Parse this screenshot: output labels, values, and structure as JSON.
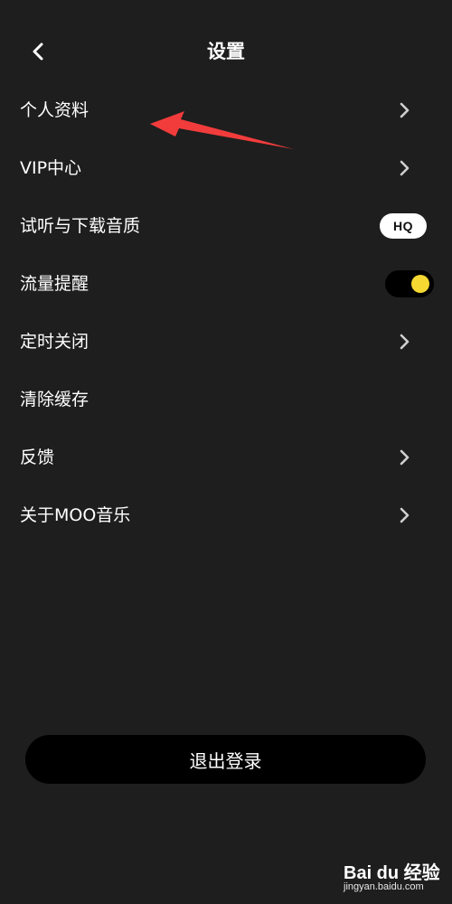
{
  "header": {
    "title": "设置",
    "back_icon": "chevron-left-icon"
  },
  "menu": {
    "items": [
      {
        "label": "个人资料",
        "control": "chevron"
      },
      {
        "label": "VIP中心",
        "control": "chevron"
      },
      {
        "label": "试听与下载音质",
        "control": "badge",
        "badge": "HQ"
      },
      {
        "label": "流量提醒",
        "control": "toggle",
        "toggle_on": true
      },
      {
        "label": "定时关闭",
        "control": "chevron"
      },
      {
        "label": "清除缓存",
        "control": "none"
      },
      {
        "label": "反馈",
        "control": "chevron"
      },
      {
        "label": "关于MOO音乐",
        "control": "chevron"
      }
    ]
  },
  "footer": {
    "logout_label": "退出登录"
  },
  "annotation": {
    "arrow_color": "#f23c3c"
  },
  "watermark": {
    "brand": "Bai du 经验",
    "url": "jingyan.baidu.com"
  },
  "colors": {
    "background": "#1e1e1e",
    "accent": "#f5d832",
    "text": "#ffffff"
  }
}
